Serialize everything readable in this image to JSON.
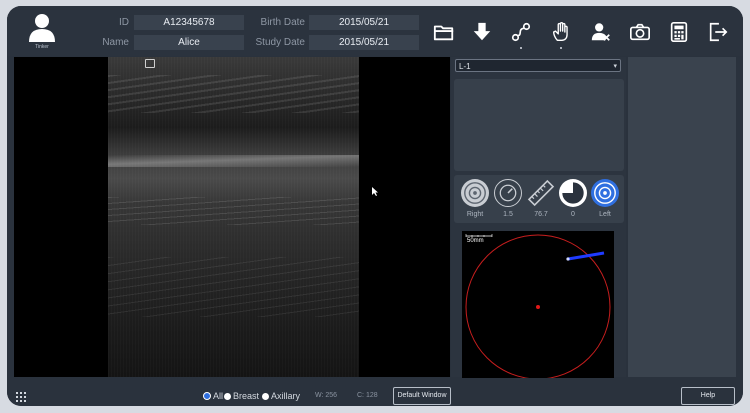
{
  "user": {
    "caption": "Tinker"
  },
  "patient": {
    "id_label": "ID",
    "id_value": "A12345678",
    "name_label": "Name",
    "name_value": "Alice",
    "birth_label": "Birth Date",
    "birth_value": "2015/05/21",
    "study_label": "Study Date",
    "study_value": "2015/05/21"
  },
  "toolbar": {
    "icons": [
      "folder-open-icon",
      "download-arrow-icon",
      "path-route-icon",
      "hand-pan-icon",
      "doctor-user-icon",
      "camera-icon",
      "calculator-icon",
      "exit-icon"
    ]
  },
  "image_select": {
    "value": "L-1"
  },
  "measurements": {
    "side_label": "Right",
    "depth_value": "1.5",
    "length_value": "76.7",
    "angle_value": "0",
    "probe_side": "Left"
  },
  "bodymark": {
    "scale_label": "50mm"
  },
  "filter": {
    "all_label": "All",
    "breast_label": "Breast",
    "axillary_label": "Axillary",
    "selected": "All"
  },
  "window": {
    "w_label": "W: 256",
    "c_label": "C: 128",
    "default_button": "Default Window"
  },
  "help_button": "Help",
  "colors": {
    "background": "#2a323d",
    "accent": "#2f6fe0",
    "marker_red": "#c81e1e",
    "probe_blue": "#1f3bff"
  }
}
